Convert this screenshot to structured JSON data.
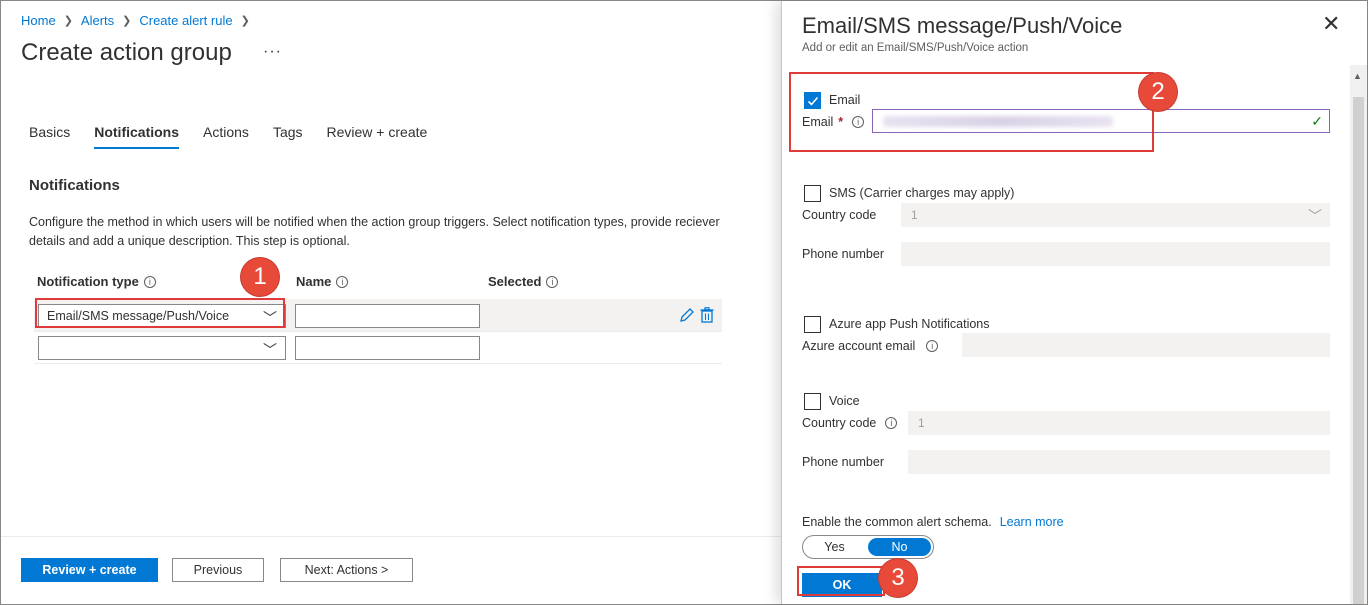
{
  "breadcrumb": [
    "Home",
    "Alerts",
    "Create alert rule"
  ],
  "page": {
    "title": "Create action group",
    "more": "···"
  },
  "tabs": [
    {
      "label": "Basics",
      "active": false
    },
    {
      "label": "Notifications",
      "active": true
    },
    {
      "label": "Actions",
      "active": false
    },
    {
      "label": "Tags",
      "active": false
    },
    {
      "label": "Review + create",
      "active": false
    }
  ],
  "notifications": {
    "section_title": "Notifications",
    "description": "Configure the method in which users will be notified when the action group triggers. Select notification types, provide reciever details and add a unique description. This step is optional.",
    "columns": {
      "type": "Notification type",
      "name": "Name",
      "selected": "Selected"
    },
    "rows": [
      {
        "type": "Email/SMS message/Push/Voice",
        "name": ""
      },
      {
        "type": "",
        "name": ""
      }
    ]
  },
  "footer": {
    "review_create": "Review + create",
    "previous": "Previous",
    "next": "Next: Actions >"
  },
  "callouts": [
    "1",
    "2",
    "3"
  ],
  "panel": {
    "title": "Email/SMS message/Push/Voice",
    "subtitle": "Add or edit an Email/SMS/Push/Voice action",
    "email": {
      "checkbox_label": "Email",
      "checked": true,
      "field_label": "Email",
      "required": "*"
    },
    "sms": {
      "checkbox_label": "SMS (Carrier charges may apply)",
      "country_label": "Country code",
      "country_value": "1",
      "phone_label": "Phone number"
    },
    "push": {
      "checkbox_label": "Azure app Push Notifications",
      "account_label": "Azure account email"
    },
    "voice": {
      "checkbox_label": "Voice",
      "country_label": "Country code",
      "country_value": "1",
      "phone_label": "Phone number"
    },
    "schema": {
      "label": "Enable the common alert schema.",
      "link": "Learn more",
      "yes": "Yes",
      "no": "No",
      "selected": "No"
    },
    "ok": "OK"
  },
  "colors": {
    "accent": "#0078d4",
    "callout": "#e84a3a"
  },
  "icons": [
    "chevron-right-icon",
    "more-icon",
    "info-icon",
    "chevron-down-icon",
    "edit-icon",
    "trash-icon",
    "close-icon",
    "checkmark-icon"
  ]
}
